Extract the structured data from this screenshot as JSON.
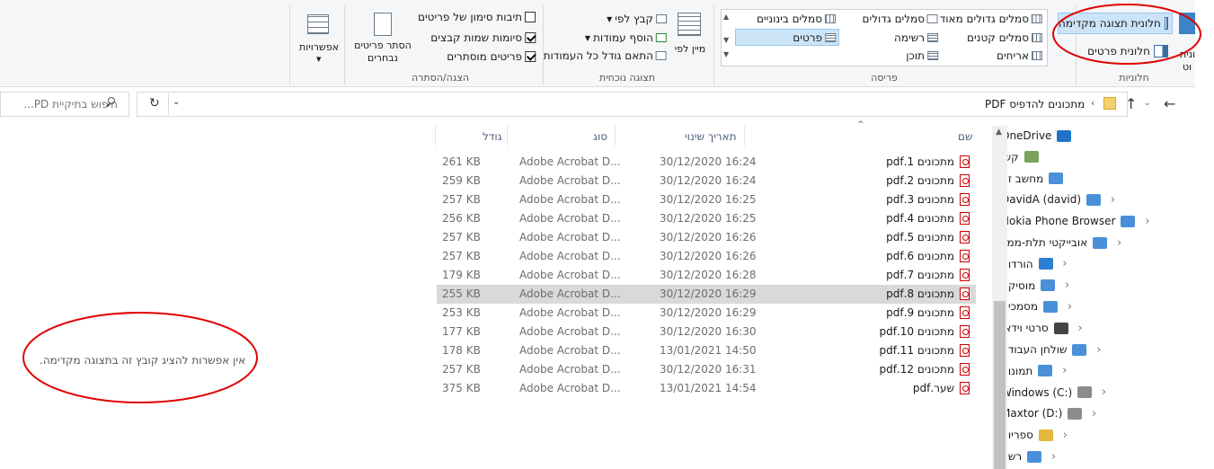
{
  "ribbon": {
    "panes_group": {
      "label": "חלוניות",
      "preview_pane": "חלונית תצוגה מקדימה",
      "details_pane": "חלונית פרטים",
      "nav_pane_partial": "ונית",
      "nav_pane_partial2": "וט"
    },
    "layout_group": {
      "label": "פריסה",
      "items": [
        "סמלים גדולים מאוד",
        "סמלים גדולים",
        "סמלים בינוניים",
        "סמלים קטנים",
        "רשימה",
        "פרטים",
        "אריחים",
        "תוכן"
      ],
      "selected": "פרטים"
    },
    "current_view_group": {
      "label": "תצוגה נוכחית",
      "sort_by": "מיין לפי",
      "group_by": "קבץ לפי",
      "add_columns": "הוסף עמודות",
      "size_all_columns": "התאם גודל כל העמודות"
    },
    "show_hide_group": {
      "label": "הצגה/הסתרה",
      "item_checkboxes": "תיבות סימון של פריטים",
      "item_checkboxes_checked": false,
      "file_extensions": "סיומות שמות קבצים",
      "file_extensions_checked": true,
      "hidden_items": "פריטים מוסתרים",
      "hidden_items_checked": true,
      "hide_selected": "הסתר פריטים נבחרים"
    },
    "options": "אפשרויות"
  },
  "address": {
    "path_folder": "PDF מתכונים להדפיס",
    "search_placeholder": "חיפוש בתיקיית PD..."
  },
  "nav_tree": [
    {
      "label": "OneDrive",
      "icon": "cloud-icon",
      "expandable": false
    },
    {
      "label": "קשי",
      "icon": "user-icon",
      "expandable": false
    },
    {
      "label": "מחשב זה",
      "icon": "computer-icon",
      "expandable": false
    },
    {
      "label": "(david) DavidA",
      "icon": "device-icon",
      "expandable": true
    },
    {
      "label": "Nokia Phone Browser",
      "icon": "phone-icon",
      "expandable": true
    },
    {
      "label": "אובייקטי תלת-ממד",
      "icon": "cube-icon",
      "expandable": true
    },
    {
      "label": "הורדות",
      "icon": "download-icon",
      "expandable": true
    },
    {
      "label": "מוסיקה",
      "icon": "music-icon",
      "expandable": true
    },
    {
      "label": "מסמכים",
      "icon": "document-icon",
      "expandable": true
    },
    {
      "label": "סרטי וידאו",
      "icon": "video-icon",
      "expandable": true
    },
    {
      "label": "שולחן העבודה",
      "icon": "desktop-icon",
      "expandable": true
    },
    {
      "label": "תמונות",
      "icon": "pictures-icon",
      "expandable": true
    },
    {
      "label": "Windows (C:)",
      "icon": "drive-icon",
      "expandable": true
    },
    {
      "label": "Maxtor (D:)",
      "icon": "drive-icon",
      "expandable": true
    },
    {
      "label": "ספריות",
      "icon": "library-icon",
      "expandable": true
    },
    {
      "label": "רשת",
      "icon": "network-icon",
      "expandable": true
    }
  ],
  "columns": {
    "name": "שם",
    "date": "תאריך שינוי",
    "type": "סוג",
    "size": "גודל"
  },
  "files": [
    {
      "name": "מתכונים 1.pdf",
      "date": "30/12/2020 16:24",
      "type": "Adobe Acrobat D...",
      "size": "261 KB",
      "selected": false
    },
    {
      "name": "מתכונים 2.pdf",
      "date": "30/12/2020 16:24",
      "type": "Adobe Acrobat D...",
      "size": "259 KB",
      "selected": false
    },
    {
      "name": "מתכונים 3.pdf",
      "date": "30/12/2020 16:25",
      "type": "Adobe Acrobat D...",
      "size": "257 KB",
      "selected": false
    },
    {
      "name": "מתכונים 4.pdf",
      "date": "30/12/2020 16:25",
      "type": "Adobe Acrobat D...",
      "size": "256 KB",
      "selected": false
    },
    {
      "name": "מתכונים 5.pdf",
      "date": "30/12/2020 16:26",
      "type": "Adobe Acrobat D...",
      "size": "257 KB",
      "selected": false
    },
    {
      "name": "מתכונים 6.pdf",
      "date": "30/12/2020 16:26",
      "type": "Adobe Acrobat D...",
      "size": "257 KB",
      "selected": false
    },
    {
      "name": "מתכונים 7.pdf",
      "date": "30/12/2020 16:28",
      "type": "Adobe Acrobat D...",
      "size": "179 KB",
      "selected": false
    },
    {
      "name": "מתכונים 8.pdf",
      "date": "30/12/2020 16:29",
      "type": "Adobe Acrobat D...",
      "size": "255 KB",
      "selected": true
    },
    {
      "name": "מתכונים 9.pdf",
      "date": "30/12/2020 16:29",
      "type": "Adobe Acrobat D...",
      "size": "253 KB",
      "selected": false
    },
    {
      "name": "מתכונים 10.pdf",
      "date": "30/12/2020 16:30",
      "type": "Adobe Acrobat D...",
      "size": "177 KB",
      "selected": false
    },
    {
      "name": "מתכונים 11.pdf",
      "date": "13/01/2021 14:50",
      "type": "Adobe Acrobat D...",
      "size": "178 KB",
      "selected": false
    },
    {
      "name": "מתכונים 12.pdf",
      "date": "30/12/2020 16:31",
      "type": "Adobe Acrobat D...",
      "size": "257 KB",
      "selected": false
    },
    {
      "name": "שער.pdf",
      "date": "13/01/2021 14:54",
      "type": "Adobe Acrobat D...",
      "size": "375 KB",
      "selected": false
    }
  ],
  "preview": {
    "message": "אין אפשרות להציג קובץ זה בתצוגה מקדימה."
  },
  "colors": {
    "annotation": "#e00000",
    "selection": "#d9d9d9",
    "accent": "#0078d7"
  }
}
